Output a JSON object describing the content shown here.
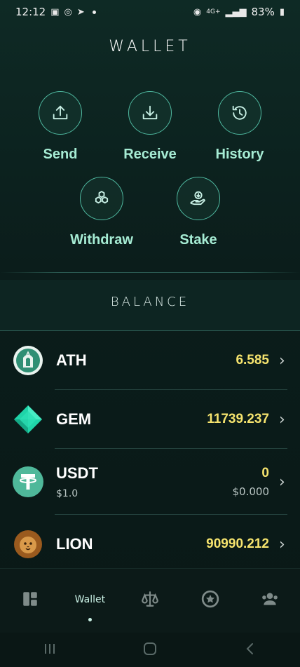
{
  "status": {
    "time": "12:12",
    "battery": "83%",
    "network": "4G+"
  },
  "header": {
    "title": "WALLET"
  },
  "actions": [
    {
      "label": "Send",
      "icon": "upload-icon"
    },
    {
      "label": "Receive",
      "icon": "download-icon"
    },
    {
      "label": "History",
      "icon": "history-icon"
    },
    {
      "label": "Withdraw",
      "icon": "hexagons-icon"
    },
    {
      "label": "Stake",
      "icon": "stake-hand-icon"
    }
  ],
  "balance": {
    "title": "BALANCE",
    "tokens": [
      {
        "symbol": "ATH",
        "amount": "6.585"
      },
      {
        "symbol": "GEM",
        "amount": "11739.237"
      },
      {
        "symbol": "USDT",
        "price": "$1.0",
        "amount": "0",
        "fiat": "$0.000"
      },
      {
        "symbol": "LION",
        "amount": "90990.212"
      }
    ]
  },
  "nav": {
    "items": [
      {
        "icon": "dashboard-icon"
      },
      {
        "label": "Wallet"
      },
      {
        "icon": "scales-icon"
      },
      {
        "icon": "star-badge-icon"
      },
      {
        "icon": "users-icon"
      }
    ]
  },
  "colors": {
    "accent": "#a6ecd4",
    "amount": "#f6e46e",
    "background": "#0b1d1b"
  }
}
